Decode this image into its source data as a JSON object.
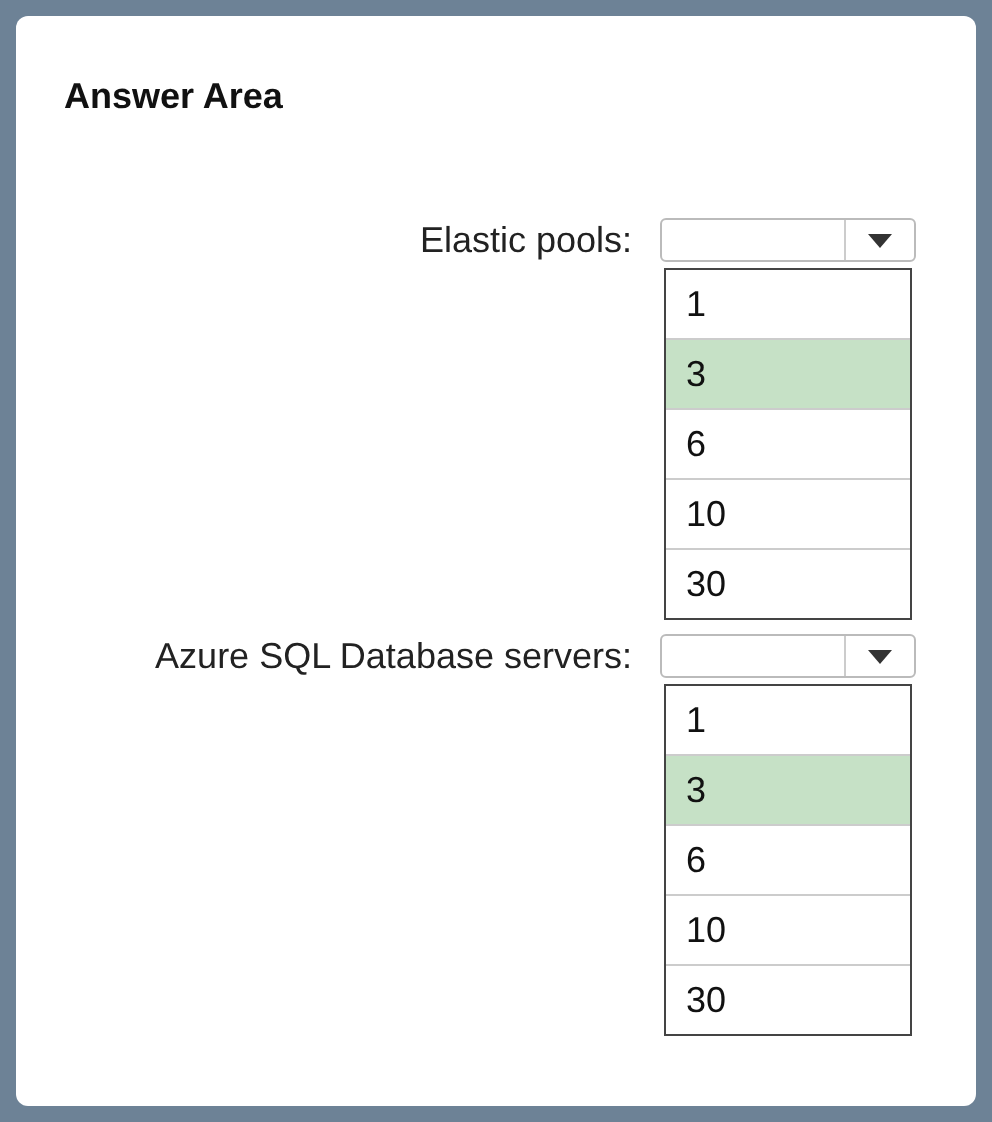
{
  "title": "Answer Area",
  "questions": [
    {
      "label": "Elastic pools:",
      "options": [
        {
          "text": "1",
          "selected": false
        },
        {
          "text": "3",
          "selected": true
        },
        {
          "text": "6",
          "selected": false
        },
        {
          "text": "10",
          "selected": false
        },
        {
          "text": "30",
          "selected": false
        }
      ]
    },
    {
      "label": "Azure SQL Database servers:",
      "options": [
        {
          "text": "1",
          "selected": false
        },
        {
          "text": "3",
          "selected": true
        },
        {
          "text": "6",
          "selected": false
        },
        {
          "text": "10",
          "selected": false
        },
        {
          "text": "30",
          "selected": false
        }
      ]
    }
  ]
}
